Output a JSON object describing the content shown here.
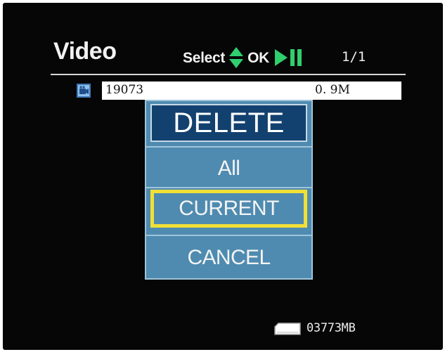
{
  "header": {
    "title": "Video",
    "hint_select": "Select",
    "hint_ok": "OK",
    "updown_icon": "up-down-arrows-icon",
    "playpause_icon": "play-pause-icon",
    "page": "1/1"
  },
  "file_list": {
    "items": [
      {
        "icon": "video-file-icon",
        "name": "19073",
        "size": "0. 9M"
      }
    ]
  },
  "dialog": {
    "title": "DELETE",
    "options": [
      {
        "label": "All",
        "selected": false
      },
      {
        "label": "CURRENT",
        "selected": true
      },
      {
        "label": "CANCEL",
        "selected": false
      }
    ],
    "highlight_color": "#f2df36",
    "panel_color": "#4f8bb0",
    "title_color": "#12416f"
  },
  "status": {
    "storage_icon": "memory-card-icon",
    "storage_free": "03773MB"
  }
}
